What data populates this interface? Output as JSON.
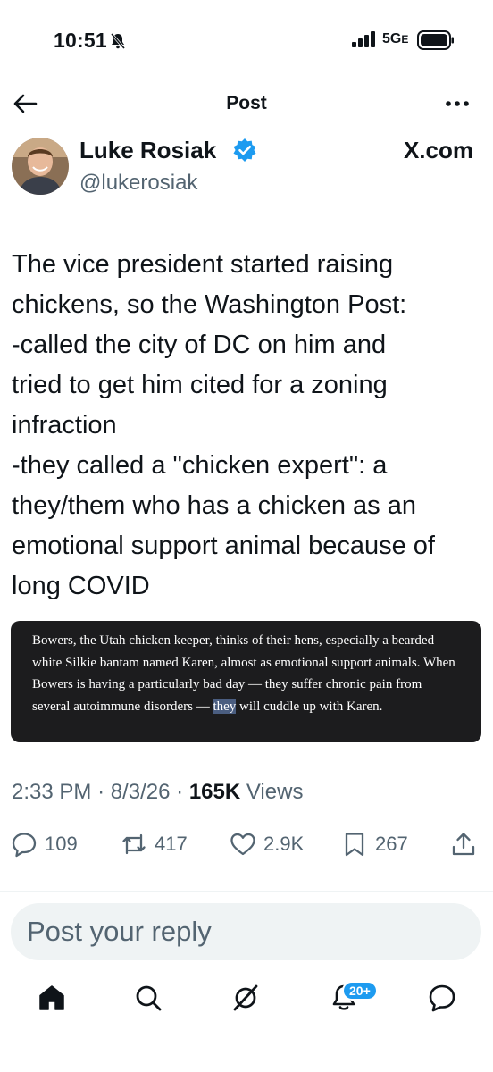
{
  "status_bar": {
    "time": "10:51",
    "network": "5G",
    "network_suffix": "E"
  },
  "header": {
    "title": "Post"
  },
  "author": {
    "name": "Luke Rosiak",
    "handle": "@lukerosiak",
    "verified": true,
    "site_label": "X.com"
  },
  "post": {
    "text": "The vice president started raising\nchickens, so the Washington Post:\n-called the city of DC on him and\ntried to get him cited for a zoning\ninfraction\n-they called a \"chicken expert\": a\nthey/them who has a chicken as an\nemotional support animal because of\nlong COVID",
    "quote": {
      "before": "Bowers, the Utah chicken keeper, thinks of their hens, especially a bearded white Silkie bantam named Karen, almost as emotional support animals. When Bowers is having a particularly bad day — they suffer chronic pain from several autoimmune disorders — ",
      "highlighted": "they",
      "after": " will cuddle up with Karen."
    },
    "time": "2:33 PM",
    "date": "8/3/26",
    "views_count": "165K",
    "views_label": "Views"
  },
  "actions": {
    "replies": "109",
    "reposts": "417",
    "likes": "2.9K",
    "bookmarks": "267"
  },
  "reply": {
    "placeholder": "Post your reply"
  },
  "bottom_nav": {
    "notifications_badge": "20+"
  },
  "colors": {
    "accent": "#1d9bf0",
    "text": "#0f1419",
    "muted": "#536471",
    "quote_bg": "#1c1c1e",
    "highlight": "#4a5d80"
  }
}
